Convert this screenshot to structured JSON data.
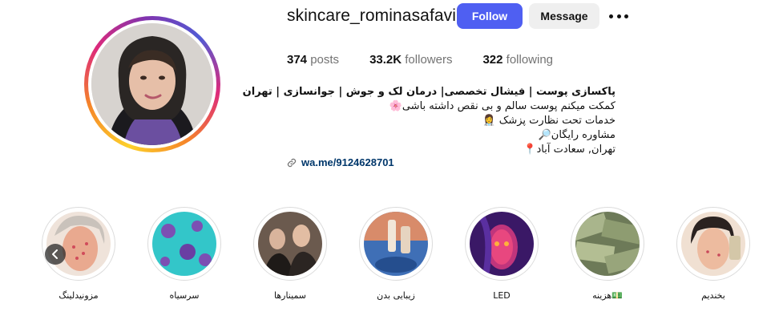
{
  "profile": {
    "username": "skincare_rominasafavi",
    "follow_label": "Follow",
    "message_label": "Message",
    "stats": {
      "posts_count": "374",
      "posts_label": "posts",
      "followers_count": "33.2K",
      "followers_label": "followers",
      "following_count": "322",
      "following_label": "following"
    },
    "bio": {
      "title": "پاکسازی پوست | فیشال تخصصی| درمان لک و جوش | جوانسازی | تهران",
      "line1": "کمکت میکنم پوست سالم و بی نقص داشته باشی🌸",
      "line2": "خدمات تحت نظارت پزشک 👩‍⚕️",
      "line3": "مشاوره رایگان🔎",
      "line4": "تهران, سعادت آباد📍"
    },
    "link": "wa.me/9124628701"
  },
  "highlights": [
    {
      "label": "مزونیدلینگ"
    },
    {
      "label": "سرسیاه"
    },
    {
      "label": "سمینارها"
    },
    {
      "label": "زیبایی بدن"
    },
    {
      "label": "LED"
    },
    {
      "label": "هزینه💵"
    },
    {
      "label": "بخندیم"
    }
  ],
  "colors": {
    "follow_button": "#4f5ff2",
    "link": "#00376b",
    "muted_text": "#737373"
  },
  "icons": [
    "more-icon",
    "link-icon",
    "chevron-left-icon"
  ]
}
